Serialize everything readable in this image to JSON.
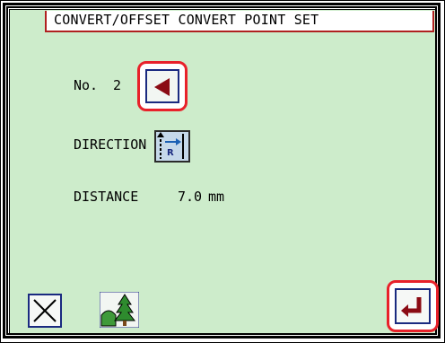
{
  "window": {
    "title": "CONVERT/OFFSET CONVERT POINT SET"
  },
  "fields": {
    "no_label": "No.",
    "no_value": "2",
    "direction_label": "DIRECTION",
    "distance_label": "DISTANCE",
    "distance_value": "7.0",
    "distance_unit": "mm"
  },
  "icons": {
    "back": "left-arrow-icon",
    "direction": "direction-right-icon",
    "cancel": "close-icon",
    "tree": "tree-icon",
    "enter": "enter-return-icon"
  },
  "colors": {
    "panel_bg": "#cdeccb",
    "highlight_red": "#e8212a",
    "arrow_red": "#8b0b14",
    "button_border": "#1a2a80"
  }
}
